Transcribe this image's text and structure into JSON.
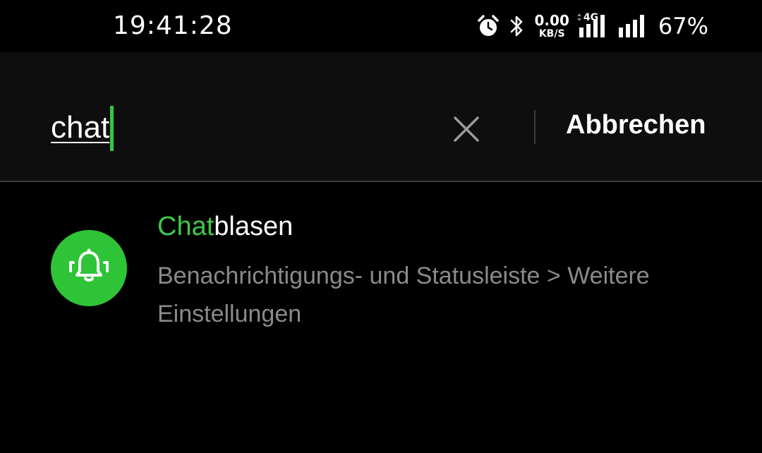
{
  "status_bar": {
    "time": "19:41:28",
    "net_speed_value": "0.00",
    "net_speed_unit": "KB/S",
    "network_type": "4G",
    "battery_percent": "67%",
    "icons": [
      "alarm-icon",
      "bluetooth-icon",
      "signal-4g-icon",
      "signal-icon"
    ]
  },
  "search": {
    "value": "chat",
    "clear_icon": "close-icon",
    "cancel_label": "Abbrechen",
    "caret_color": "#34c93c"
  },
  "results": [
    {
      "icon": "bell-icon",
      "icon_bg": "#2fc437",
      "title_highlight": "Chat",
      "title_rest": "blasen",
      "subtitle": "Benachrichtigungs- und Statusleiste > Weitere Einstellungen"
    }
  ],
  "colors": {
    "accent": "#2fc437",
    "background": "#000000",
    "header_background": "#0e0e0e",
    "secondary_text": "#8a8a8a"
  }
}
